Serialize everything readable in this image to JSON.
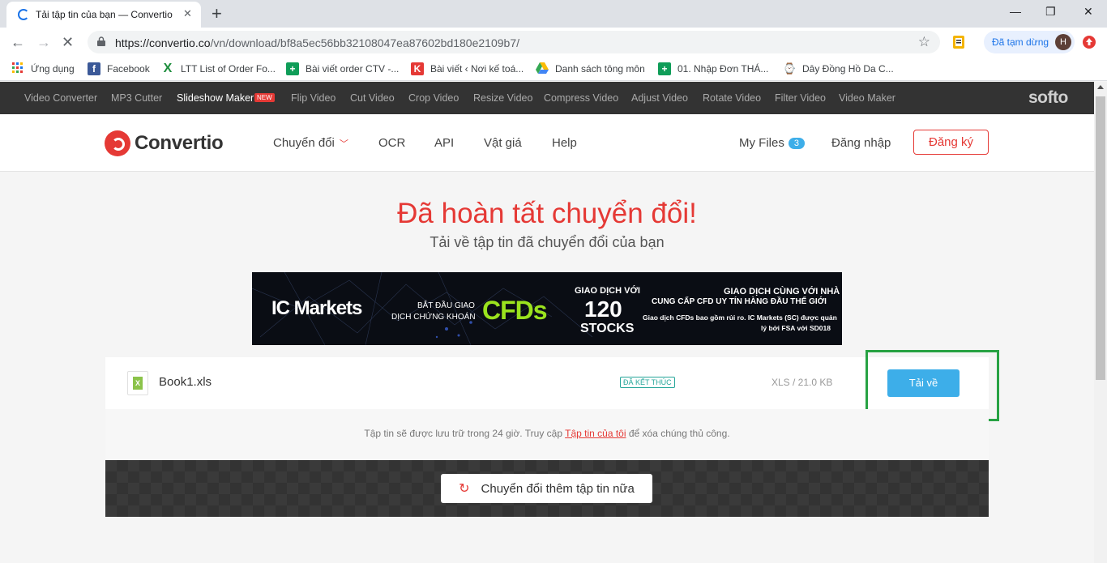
{
  "browser": {
    "tab_title": "Tải tập tin của bạn — Convertio",
    "url_host": "https://convertio.co",
    "url_path": "/vn/download/bf8a5ec56bb32108047ea87602bd180e2109b7/",
    "profile_status": "Đã tạm dừng",
    "profile_initial": "H",
    "bookmarks": [
      {
        "label": "Ứng dụng",
        "icon": "apps-grid-icon"
      },
      {
        "label": "Facebook",
        "icon": "facebook-icon"
      },
      {
        "label": "LTT List of Order Fo...",
        "icon": "excel-x-icon"
      },
      {
        "label": "Bài viết order CTV -...",
        "icon": "sheets-icon"
      },
      {
        "label": "Bài viết ‹ Nơi kế toá...",
        "icon": "k-icon"
      },
      {
        "label": "Danh sách tông môn",
        "icon": "drive-icon"
      },
      {
        "label": "01. Nhập Đơn THÁ...",
        "icon": "sheets-icon"
      },
      {
        "label": "Dây Đồng Hồ Da C...",
        "icon": "watch-icon"
      }
    ]
  },
  "softo_bar": {
    "tools": [
      "Video Converter",
      "MP3 Cutter",
      "Slideshow Maker",
      "Flip Video",
      "Cut Video",
      "Crop Video",
      "Resize Video",
      "Compress Video",
      "Adjust Video",
      "Rotate Video",
      "Filter Video",
      "Video Maker"
    ],
    "new_badge": "NEW",
    "brand": "softo"
  },
  "header": {
    "logo_text": "Convertio",
    "nav": [
      "Chuyển đổi",
      "OCR",
      "API",
      "Vật giá",
      "Help"
    ],
    "my_files": "My Files",
    "my_files_count": "3",
    "login": "Đăng nhập",
    "signup": "Đăng ký"
  },
  "main": {
    "headline": "Đã hoàn tất chuyển đổi!",
    "subheadline": "Tải về tập tin đã chuyển đổi của bạn",
    "banner": {
      "brand": "IC Markets",
      "line1": "BẮT ĐẦU GIAO",
      "line2": "DỊCH CHỨNG KHOÁN",
      "cfds": "CFDs",
      "trade_with": "GIAO DỊCH VỚI",
      "count": "120",
      "stocks": "STOCKS",
      "right1": "GIAO DỊCH CÙNG VỚI NHÀ",
      "right2": "CUNG CẤP CFD UY TÍN HÀNG ĐẦU THẾ GIỚI",
      "right3": "Giao dịch CFDs bao gồm rủi ro. IC Markets (SC) được quản",
      "right4": "lý bởi FSA với SD018"
    },
    "file": {
      "icon_letter": "X",
      "name": "Book1.xls",
      "status": "ĐÃ KẾT THÚC",
      "size": "XLS / 21.0 KB",
      "download": "Tải về"
    },
    "note_before": "Tập tin sẽ được lưu trữ trong 24 giờ. Truy cập ",
    "note_link": "Tập tin của tôi",
    "note_after": " để xóa chúng thủ công.",
    "convert_more": "Chuyển đổi thêm tập tin nữa"
  }
}
